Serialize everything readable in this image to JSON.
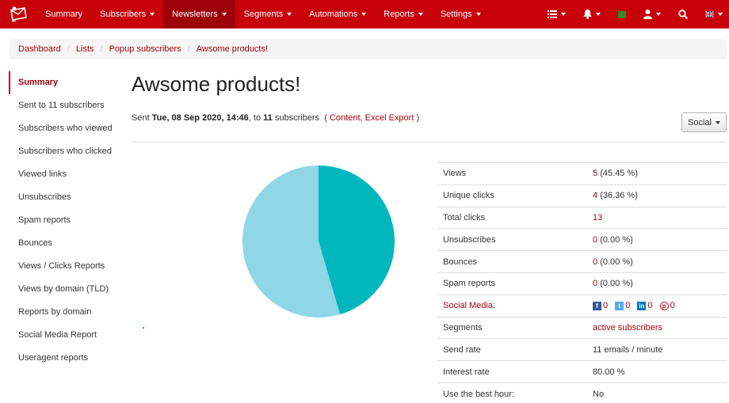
{
  "navbar": {
    "items": [
      {
        "label": "Summary",
        "dropdown": false,
        "active": false
      },
      {
        "label": "Subscribers",
        "dropdown": true,
        "active": false
      },
      {
        "label": "Newsletters",
        "dropdown": true,
        "active": true
      },
      {
        "label": "Segments",
        "dropdown": true,
        "active": false
      },
      {
        "label": "Automations",
        "dropdown": true,
        "active": false
      },
      {
        "label": "Reports",
        "dropdown": true,
        "active": false
      },
      {
        "label": "Settings",
        "dropdown": true,
        "active": false
      }
    ],
    "right_icons": [
      "list-icon",
      "bell-icon",
      "flag-icon",
      "user-icon",
      "search-icon",
      "uk-flag-icon"
    ]
  },
  "breadcrumb": [
    "Dashboard",
    "Lists",
    "Popup subscribers",
    "Awsome products!"
  ],
  "sidebar": {
    "items": [
      "Summary",
      "Sent to 11 subscribers",
      "Subscribers who viewed",
      "Subscribers who clicked",
      "Viewed links",
      "Unsubscribes",
      "Spam reports",
      "Bounces",
      "Views / Clicks Reports",
      "Views by domain (TLD)",
      "Reports by domain",
      "Social Media Report",
      "Useragent reports"
    ]
  },
  "main": {
    "title": "Awsome products!",
    "sent": {
      "prefix": "Sent",
      "date": "Tue, 08 Sep 2020, 14:46",
      "to": ", to",
      "count": "11",
      "suffix": "subscribers",
      "open_paren": "(",
      "content_link": "Content",
      "export_link": "Excel Export",
      "close_paren": ")"
    },
    "social_button": "Social"
  },
  "chart_data": {
    "type": "pie",
    "values": [
      45.45,
      54.55
    ],
    "colors": [
      "#00b7bd",
      "#8fd6e6"
    ]
  },
  "stats": {
    "views": {
      "label": "Views",
      "value": "5",
      "extra": "(45.45 %)"
    },
    "unique_clicks": {
      "label": "Unique clicks",
      "value": "4",
      "extra": "(36.36 %)"
    },
    "total_clicks": {
      "label": "Total clicks",
      "value": "13"
    },
    "unsubscribes": {
      "label": "Unsubscribes",
      "value": "0",
      "extra": "(0.00 %)"
    },
    "bounces": {
      "label": "Bounces",
      "value": "0",
      "extra": "(0.00 %)"
    },
    "spam": {
      "label": "Spam reports",
      "value": "0",
      "extra": "(0.00 %)"
    },
    "social": {
      "label": "Social Media:",
      "facebook": "0",
      "twitter": "0",
      "linkedin": "0",
      "pinterest": "0"
    },
    "segments": {
      "label": "Segments",
      "value": "active subscribers"
    },
    "send_rate": {
      "label": "Send rate",
      "value": "11 emails / minute"
    },
    "interest_rate": {
      "label": "Interest rate",
      "value": "80.00 %"
    },
    "best_hour": {
      "label": "Use the best hour:",
      "value": "No"
    }
  }
}
